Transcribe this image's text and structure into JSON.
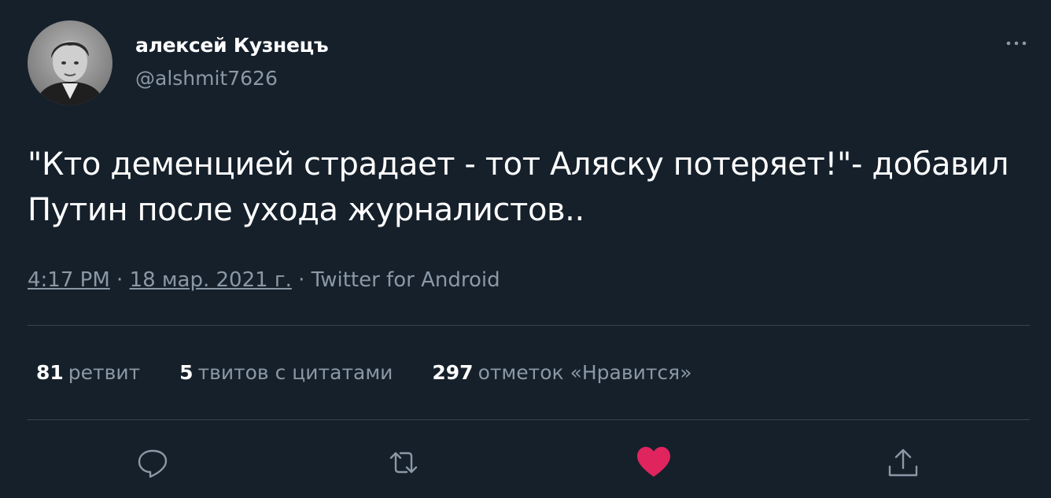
{
  "author": {
    "display_name": "алексей Кузнецъ",
    "handle": "@alshmit7626"
  },
  "tweet": {
    "text": "\"Кто деменцией страдает - тот Аляску потеряет!\"- добавил Путин после ухода журналистов..",
    "time": "4:17 PM",
    "separator_1": " · ",
    "date": "18 мар. 2021 г.",
    "separator_2": " · ",
    "source": "Twitter for Android"
  },
  "stats": {
    "retweets_count": "81",
    "retweets_label": "ретвит",
    "quotes_count": "5",
    "quotes_label": "твитов с цитатами",
    "likes_count": "297",
    "likes_label": "отметок «Нравится»"
  },
  "actions": {
    "reply": "reply-icon",
    "retweet": "retweet-icon",
    "like": "heart-icon",
    "share": "share-icon"
  },
  "colors": {
    "background": "#15202b",
    "secondary_text": "#8b98a5",
    "divider": "#38444d",
    "like_active": "#e0245e"
  }
}
